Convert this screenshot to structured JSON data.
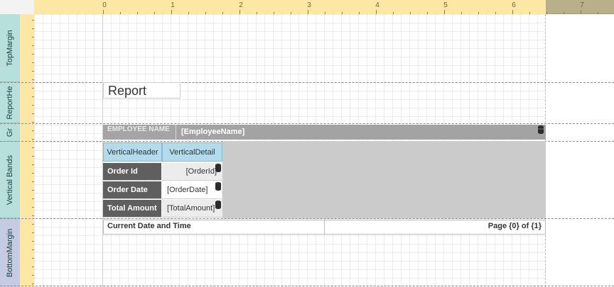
{
  "ruler": {
    "numbers": [
      "0",
      "1",
      "2",
      "3",
      "4",
      "5",
      "6",
      "7"
    ]
  },
  "bands": [
    {
      "label": "TopMargin"
    },
    {
      "label": "ReportHe"
    },
    {
      "label": "Gr"
    },
    {
      "label": "Vertical Bands"
    },
    {
      "label": "BottomMargin"
    }
  ],
  "report_header": {
    "title": "Report"
  },
  "group_header": {
    "label": "EMPLOYEE NAME",
    "field": "[EmployeeName]"
  },
  "vertical_bands": {
    "header_tab": "VerticalHeader",
    "detail_tab": "VerticalDetail",
    "rows": [
      {
        "label": "Order Id",
        "field": "[OrderId]"
      },
      {
        "label": "Order Date",
        "field": "[OrderDate]"
      },
      {
        "label": "Total Amount",
        "field": "[TotalAmount]"
      }
    ]
  },
  "page_footer": {
    "left": "Current Date and Time",
    "right": "Page {0} of {1}"
  },
  "colors": {
    "band_tab": "#b7e0dc",
    "bottom_tab": "#c4cbe3",
    "ruler": "#fde7a4",
    "label_bg": "#5f5f5f",
    "tab_blue": "#b2dcec"
  },
  "icons": {
    "field_binding": "database-icon"
  }
}
